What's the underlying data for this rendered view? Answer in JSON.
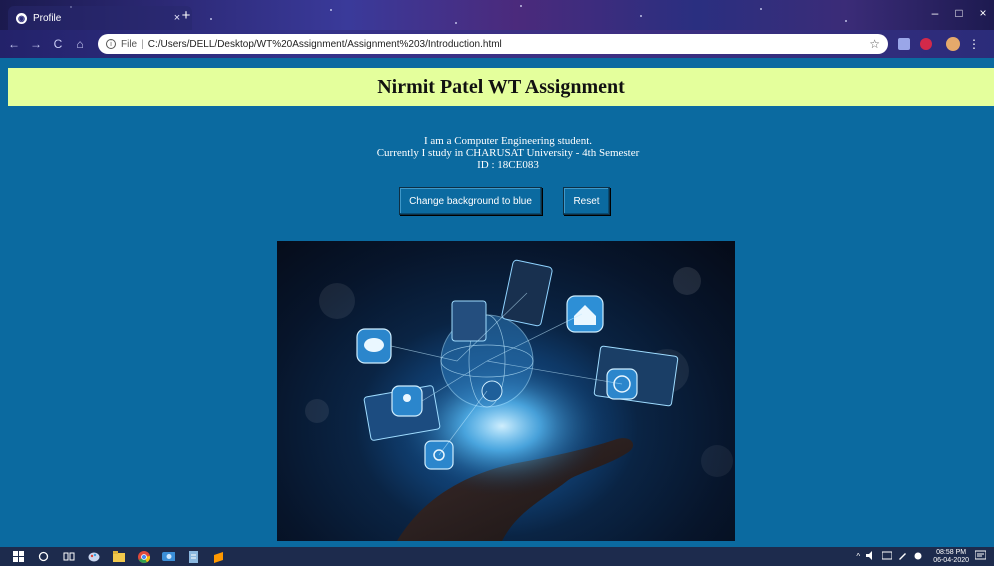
{
  "browser": {
    "tab_title": "Profile",
    "tab_favicon": "chrome-icon",
    "tab_close": "×",
    "new_tab": "+",
    "window_minimize": "–",
    "window_maximize": "□",
    "window_close": "×",
    "nav": {
      "back": "←",
      "forward": "→",
      "reload": "C",
      "home": "⌂"
    },
    "address": {
      "info_icon": "i",
      "scheme": "File",
      "separator": "|",
      "url": "C:/Users/DELL/Desktop/WT%20Assignment/Assignment%203/Introduction.html"
    },
    "bookmark_icon": "☆",
    "menu": "⋮"
  },
  "page": {
    "header_bg": "#e4ff9c",
    "body_bg": "#0b6aa0",
    "title": "Nirmit Patel WT Assignment",
    "intro_lines": [
      "I am a Computer Engineering student.",
      "Currently I study in CHARUSAT University - 4th Semester",
      "ID : 18CE083"
    ],
    "buttons": {
      "change_bg": "Change background to blue",
      "reset": "Reset"
    },
    "hero_image": "technology-network-hand-image"
  },
  "taskbar": {
    "icons": [
      "windows-start-icon",
      "search-icon",
      "task-view-icon",
      "paint-icon",
      "file-explorer-icon",
      "chrome-icon",
      "photos-icon",
      "notepad-icon",
      "sublime-text-icon"
    ],
    "tray": {
      "caret": "^",
      "time": "08:58 PM",
      "date": "06-04-2020",
      "notifications_icon": "notifications-icon"
    }
  }
}
